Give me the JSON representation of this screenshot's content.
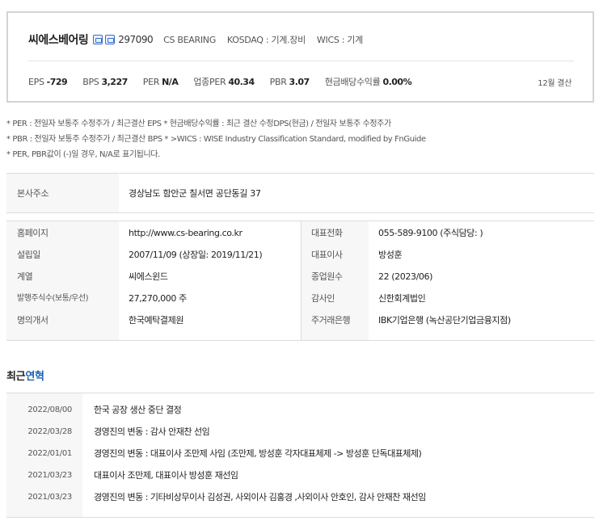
{
  "header": {
    "company_name": "씨에스베어링",
    "market_icons": [
      "market-icon",
      "company-icon"
    ],
    "stock_code": "297090",
    "english_name": "CS BEARING",
    "market": "KOSDAQ : 기계.장비",
    "wics": "WICS : 기계",
    "metrics": [
      {
        "label": "EPS",
        "value": "-729"
      },
      {
        "label": "BPS",
        "value": "3,227"
      },
      {
        "label": "PER",
        "value": "N/A"
      },
      {
        "label": "업종PER",
        "value": "40.34"
      },
      {
        "label": "PBR",
        "value": "3.07"
      },
      {
        "label": "현금배당수익률",
        "value": "0.00%"
      }
    ],
    "fiscal": "12월 결산"
  },
  "notes": [
    "* PER : 전일자 보통주 수정주가 / 최근결산 EPS * 현금배당수익률 : 최근 결산 수정DPS(현금) / 전일자 보통주 수정주가",
    "* PBR : 전일자 보통주 수정주가 / 최근결산 BPS * >WICS : WISE Industry Classification Standard, modified by FnGuide",
    "* PER, PBR값이 (-)일 경우, N/A로 표기됩니다."
  ],
  "address": {
    "label": "본사주소",
    "value": "경상남도 함안군 칠서면 공단동길 37"
  },
  "info_left": [
    {
      "label": "홈페이지",
      "value": "http://www.cs-bearing.co.kr"
    },
    {
      "label": "설립일",
      "value": "2007/11/09 (상장일: 2019/11/21)"
    },
    {
      "label": "계열",
      "value": "씨에스윈드"
    },
    {
      "label": "발행주식수(보통/우선)",
      "value": "27,270,000 주"
    },
    {
      "label": "명의개서",
      "value": "한국예탁결제원"
    }
  ],
  "info_right": [
    {
      "label": "대표전화",
      "value": "055-589-9100 (주식담당: )"
    },
    {
      "label": "대표이사",
      "value": "방성훈"
    },
    {
      "label": "종업원수",
      "value": "22 (2023/06)"
    },
    {
      "label": "감사인",
      "value": "신한회계법인"
    },
    {
      "label": "주거래은행",
      "value": "IBK기업은행 (녹산공단기업금융지점)"
    }
  ],
  "history": {
    "title_prefix": "최근",
    "title_accent": "연혁",
    "items": [
      {
        "date": "2022/08/00",
        "event": "한국 공장 생산 중단 결정"
      },
      {
        "date": "2022/03/28",
        "event": "경영진의 변동 : 감사 안재찬 선임"
      },
      {
        "date": "2022/01/01",
        "event": "경영진의 변동 : 대표이사 조만제 사임 (조만제, 방성훈 각자대표체제 -> 방성훈 단독대표체제)"
      },
      {
        "date": "2021/03/23",
        "event": "대표이사 조만제, 대표이사 방성훈 재선임"
      },
      {
        "date": "2021/03/23",
        "event": "경영진의 변동 : 기타비상무이사 김성권, 사외이사 김홍경 ,사외이사 안호인, 감사 안재찬 재선임"
      }
    ]
  }
}
